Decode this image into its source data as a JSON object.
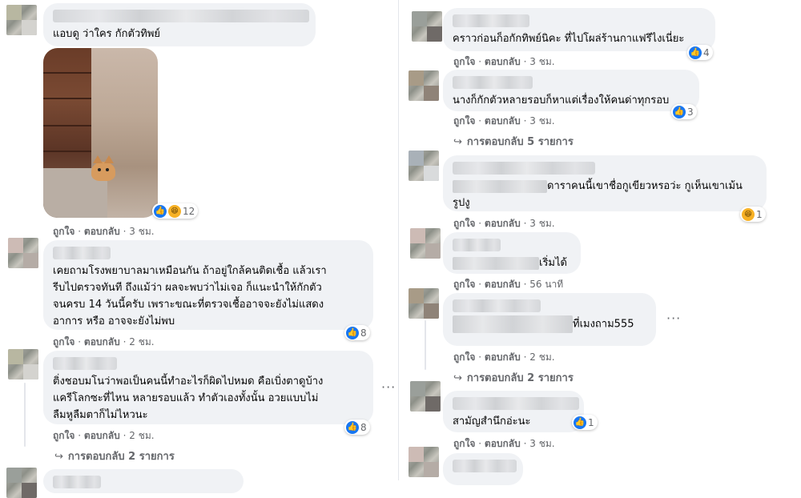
{
  "labels": {
    "like": "ถูกใจ",
    "reply": "ตอบกลับ",
    "sep": "·",
    "more": "···"
  },
  "left": [
    {
      "text": "แอบดู ว่าใคร กักตัวทิพย์",
      "time": "3 ชม.",
      "reaction_count": "12",
      "has_photo": true
    },
    {
      "text": "เคยถามโรงพยาบาลมาเหมือนกัน ถ้าอยู่ใกล้คนติดเชื้อ แล้วเรา\nรีบไปตรวจทันที ถึงแม้ว่า ผลจะพบว่าไม่เจอ ก็แนะนำให้กักตัว\nจนครบ 14 วันนี้ครับ เพราะขณะที่ตรวจเชื้ออาจจะยังไม่แสดง\nอาการ หรือ อาจจะยังไม่พบ",
      "time": "2 ชม.",
      "reaction_count": "8"
    },
    {
      "text": "ติ่งชอบมโนว่าพอเป็นคนนี้ทำอะไรก็ผิดไปหมด คือเบิ่งตาดูบ้าง\nแครีโลกซะที่ไหน หลายรอบแล้ว ทำตัวเองทั้งนั้น อวยแบบไม่\nลืมหูลืมตาก็ไม่ไหวนะ",
      "time": "2 ชม.",
      "reaction_count": "8",
      "replies": "การตอบกลับ 2 รายการ"
    }
  ],
  "right": [
    {
      "text": "คราวก่อนก็อกักทิพย์นิคะ ที่ไปโผล่ร้านกาแฟรึไงเนี่ยะ",
      "time": "3 ชม.",
      "reaction_count": "4"
    },
    {
      "text": "นางก็กักตัวหลายรอบก็หาแต่เรื่องให้คนด่าทุกรอบ",
      "time": "3 ชม.",
      "reaction_count": "3",
      "replies": "การตอบกลับ 5 รายการ"
    },
    {
      "text_tail": "ดาราคนนี้เขาชื่อกูเขียวหรอว่ะ กูเห็นเขาเม้น",
      "text_line2": "รูปงู",
      "time": "3 ชม.",
      "reaction_count": "1"
    },
    {
      "text_tail": "เริ่มได้",
      "time": "56 นาที"
    },
    {
      "text_tail": "ที่เมงถาม555",
      "time": "2 ชม.",
      "replies": "การตอบกลับ 2 รายการ"
    },
    {
      "text": "สามัญสำนึกอ่ะนะ",
      "time": "3 ชม.",
      "reaction_count": "1"
    }
  ],
  "colors": {
    "bubble": "#f0f2f5",
    "meta": "#65676b",
    "like": "#1877f2",
    "haha": "#f7b125"
  }
}
